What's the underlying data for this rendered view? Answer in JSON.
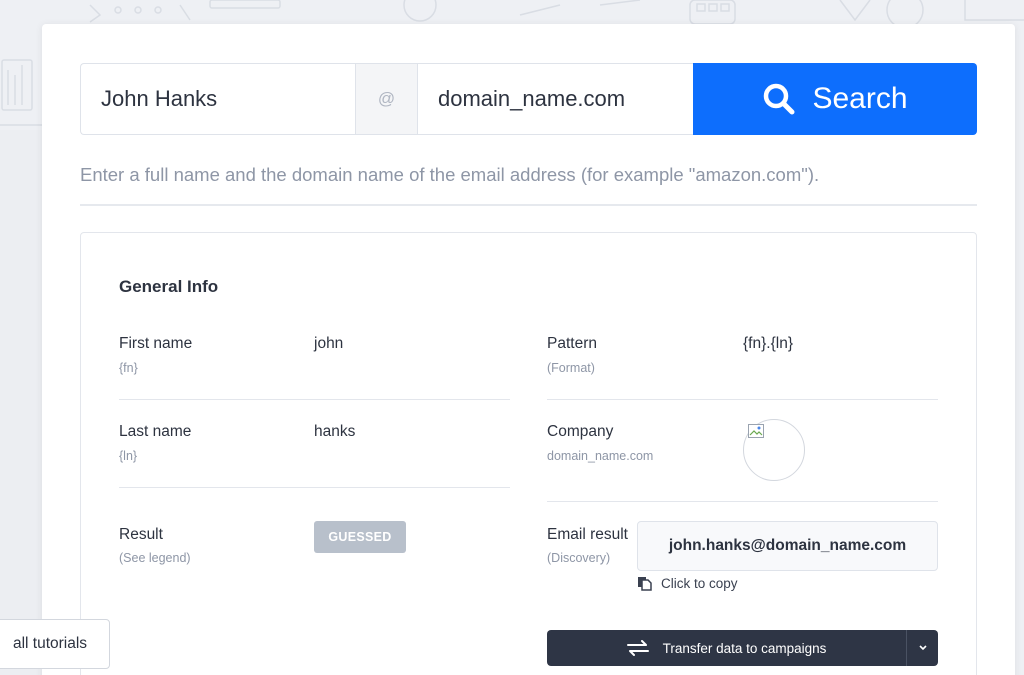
{
  "search": {
    "name_value": "John Hanks",
    "at_symbol": "@",
    "domain_value": "domain_name.com",
    "button_label": "Search"
  },
  "hint": "Enter a full name and the domain name of the email address (for example \"amazon.com\").",
  "general_info": {
    "title": "General Info",
    "first_name": {
      "label": "First name",
      "sub": "{fn}",
      "value": "john"
    },
    "last_name": {
      "label": "Last name",
      "sub": "{ln}",
      "value": "hanks"
    },
    "result": {
      "label": "Result",
      "sub": "(See legend)",
      "badge": "GUESSED"
    },
    "pattern": {
      "label": "Pattern",
      "sub": "(Format)",
      "value": "{fn}.{ln}"
    },
    "company": {
      "label": "Company",
      "sub": "domain_name.com"
    },
    "email_result": {
      "label": "Email result",
      "sub": "(Discovery)",
      "value": "john.hanks@domain_name.com",
      "copy_label": "Click to copy"
    }
  },
  "transfer_button": "Transfer data to campaigns",
  "tutorials_button": "all tutorials",
  "colors": {
    "accent": "#0d6efd",
    "dark_button": "#2e3545",
    "badge": "#b8c0cb"
  }
}
